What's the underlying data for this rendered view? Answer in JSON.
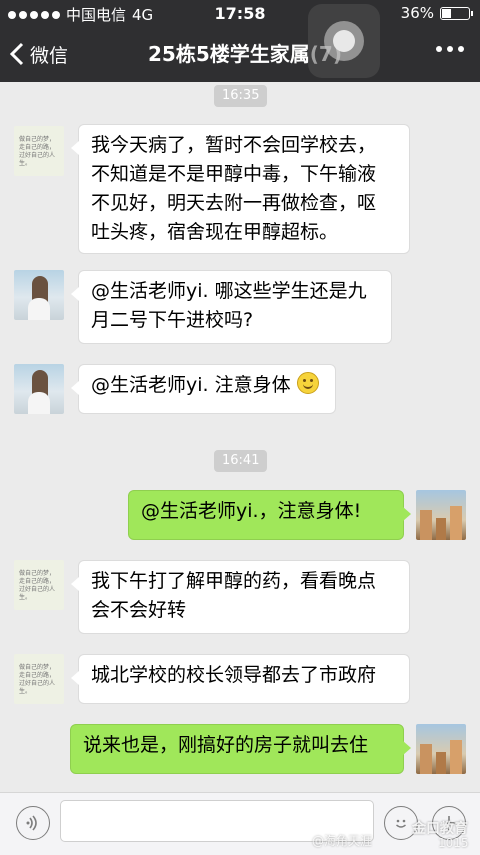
{
  "status_bar": {
    "carrier": "中国电信",
    "network": "4G",
    "time": "17:58",
    "battery": "36%",
    "battery_level": 0.36
  },
  "nav": {
    "back_label": "微信",
    "title": "25栋5楼学生家属(7)"
  },
  "messages": {
    "ts1": "16:35",
    "m1": [
      "我今天病了，暂时不会回学校去，",
      "不知道是不是甲醇中毒，下午输液",
      "不见好，明天去附一再做检查，呕",
      "吐头疼，宿舍现在甲醇超标。"
    ],
    "m2": [
      "@生活老师yi. 哪这些学生还是九",
      "月二号下午进校吗?"
    ],
    "m3": "@生活老师yi. 注意身体",
    "ts2": "16:41",
    "m4": "@生活老师yi.，注意身体!",
    "m5": [
      "我下午打了解甲醇的药，看看晚点",
      "会不会好转"
    ],
    "m6": "城北学校的校长领导都去了市政府",
    "m7": "说来也是，刚搞好的房子就叫去住"
  },
  "avatar_text": [
    "做自己的梦，",
    "走自己的路，",
    "过好自己的人生。"
  ],
  "watermarks": {
    "weibo": "@海角天涯",
    "brand": "金口教育",
    "number": "1015"
  }
}
